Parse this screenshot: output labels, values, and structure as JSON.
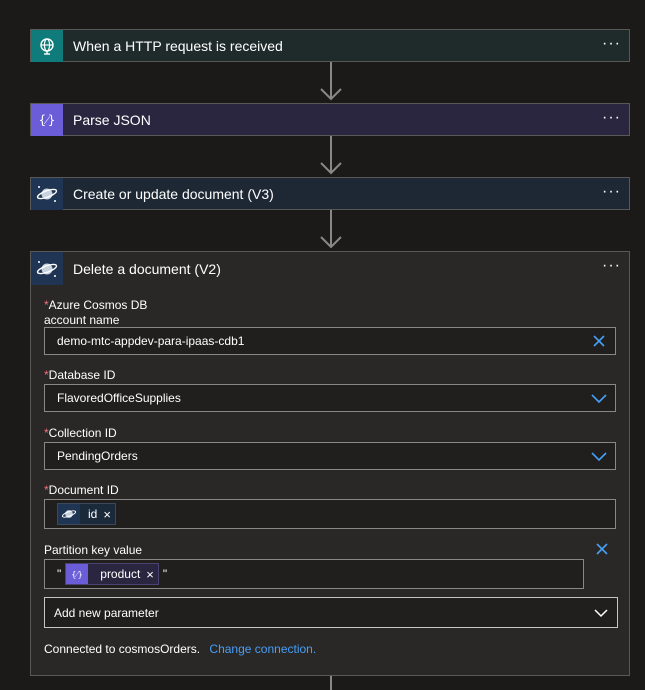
{
  "steps": [
    {
      "title": "When a HTTP request is received",
      "icon": "http-request-icon",
      "color": "#0f7b7b"
    },
    {
      "title": "Parse JSON",
      "icon": "parse-json-icon",
      "color": "#6b5dd8"
    },
    {
      "title": "Create or update document (V3)",
      "icon": "cosmos-db-icon",
      "color": "#1f3553"
    },
    {
      "title": "Delete a document (V2)",
      "icon": "cosmos-db-icon",
      "color": "#1f3553"
    }
  ],
  "more_label": "···",
  "form": {
    "account_label_1": "Azure Cosmos DB",
    "account_label_2": "account name",
    "account_value": "demo-mtc-appdev-para-ipaas-cdb1",
    "database_label": "Database ID",
    "database_value": "FlavoredOfficeSupplies",
    "collection_label": "Collection ID",
    "collection_value": "PendingOrders",
    "document_label": "Document ID",
    "document_token": "id",
    "partition_label": "Partition key value",
    "partition_quote": "\"",
    "partition_token": "product",
    "add_param": "Add new parameter",
    "required_mark": "*",
    "remove_mark": "×"
  },
  "footer": {
    "connected_text": "Connected to cosmosOrders.",
    "change_link": "Change connection."
  }
}
